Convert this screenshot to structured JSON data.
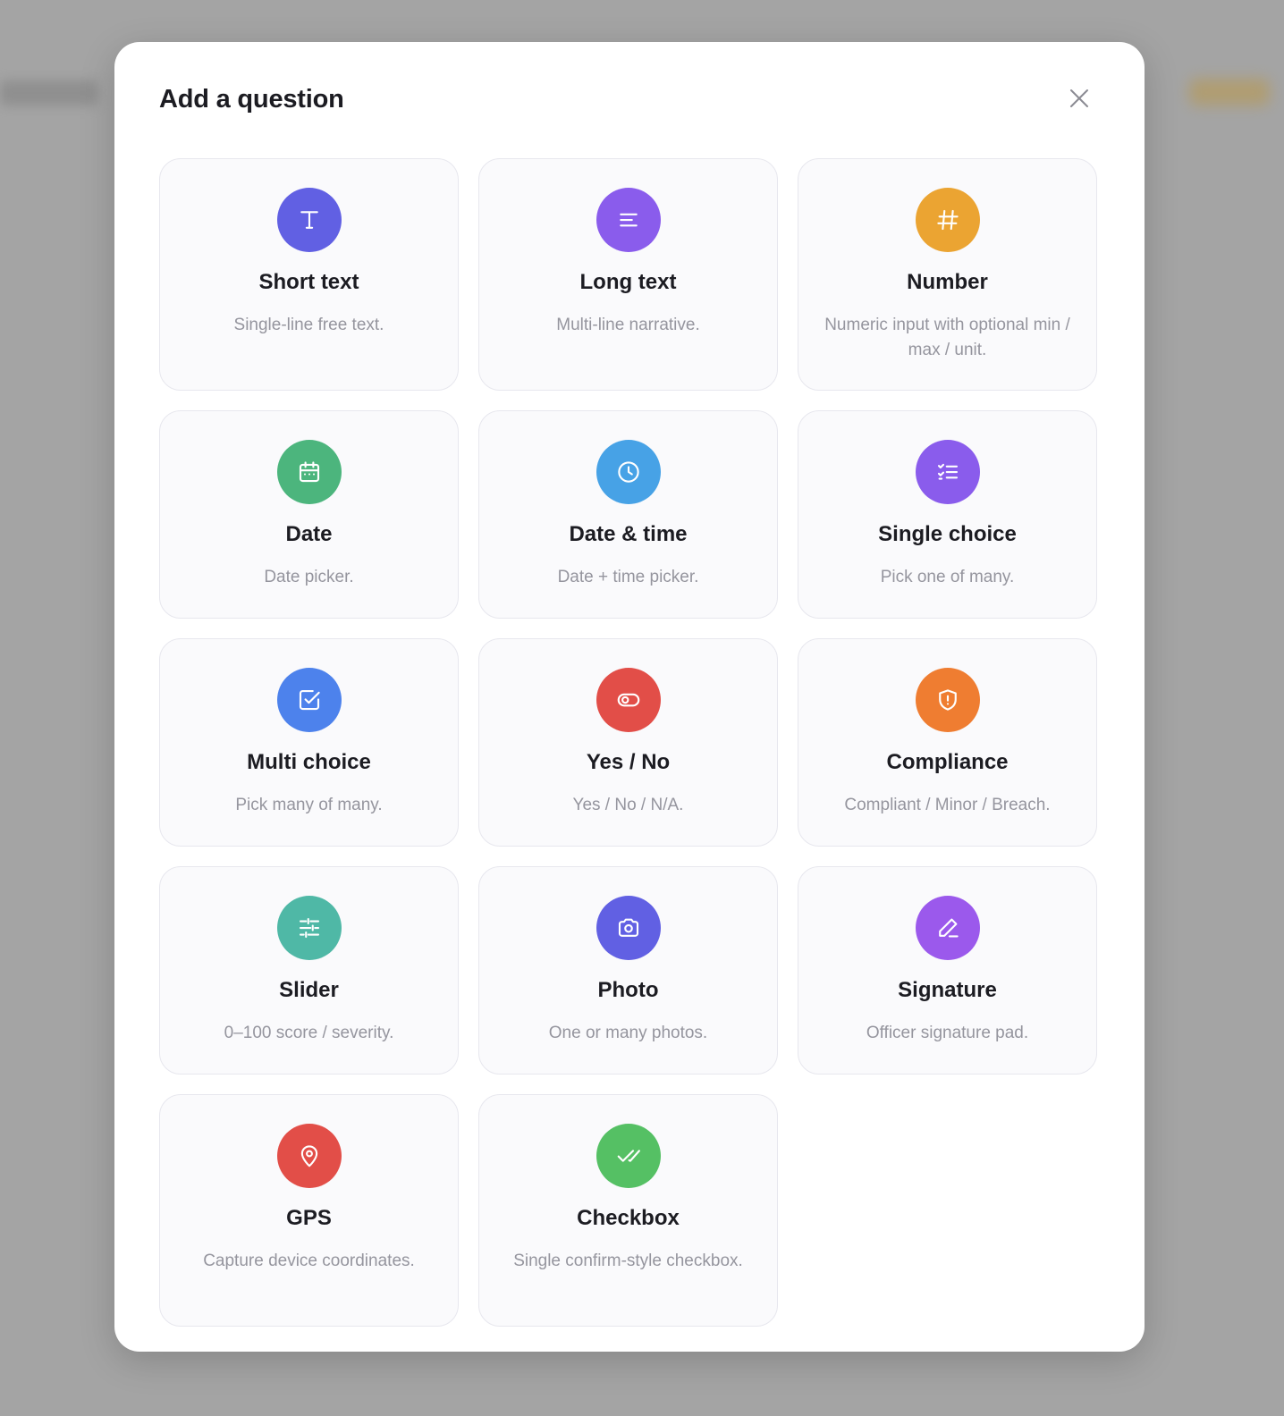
{
  "dialog": {
    "title": "Add a question",
    "close_icon": "close-icon"
  },
  "question_types": [
    {
      "key": "short-text",
      "title": "Short text",
      "description": "Single-line free text.",
      "icon": "text-t-icon",
      "color": "#6160e3"
    },
    {
      "key": "long-text",
      "title": "Long text",
      "description": "Multi-line narrative.",
      "icon": "align-left-icon",
      "color": "#8a5cec"
    },
    {
      "key": "number",
      "title": "Number",
      "description": "Numeric input with optional min / max / unit.",
      "icon": "hash-icon",
      "color": "#eba432"
    },
    {
      "key": "date",
      "title": "Date",
      "description": "Date picker.",
      "icon": "calendar-icon",
      "color": "#4cb57d"
    },
    {
      "key": "date-time",
      "title": "Date & time",
      "description": "Date + time picker.",
      "icon": "clock-icon",
      "color": "#47a2e6"
    },
    {
      "key": "single-choice",
      "title": "Single choice",
      "description": "Pick one of many.",
      "icon": "list-checks-icon",
      "color": "#8a5cec"
    },
    {
      "key": "multi-choice",
      "title": "Multi choice",
      "description": "Pick many of many.",
      "icon": "checkbox-square-icon",
      "color": "#4d82ec"
    },
    {
      "key": "yes-no",
      "title": "Yes / No",
      "description": "Yes / No / N/A.",
      "icon": "toggle-icon",
      "color": "#e24e48"
    },
    {
      "key": "compliance",
      "title": "Compliance",
      "description": "Compliant / Minor / Breach.",
      "icon": "shield-alert-icon",
      "color": "#ef7d31"
    },
    {
      "key": "slider",
      "title": "Slider",
      "description": "0–100 score / severity.",
      "icon": "sliders-icon",
      "color": "#4fb8a6"
    },
    {
      "key": "photo",
      "title": "Photo",
      "description": "One or many photos.",
      "icon": "camera-icon",
      "color": "#6160e3"
    },
    {
      "key": "signature",
      "title": "Signature",
      "description": "Officer signature pad.",
      "icon": "pen-icon",
      "color": "#9b59ec"
    },
    {
      "key": "gps",
      "title": "GPS",
      "description": "Capture device coordinates.",
      "icon": "map-pin-icon",
      "color": "#e24e48"
    },
    {
      "key": "checkbox",
      "title": "Checkbox",
      "description": "Single confirm-style checkbox.",
      "icon": "double-check-icon",
      "color": "#55c064"
    }
  ]
}
